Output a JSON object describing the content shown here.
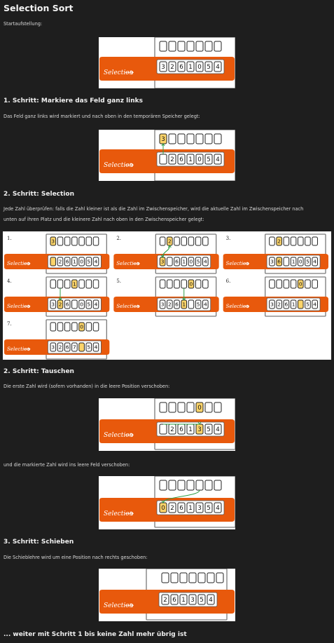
{
  "title": "Selection Sort",
  "start_label": "Startaufstellung:",
  "step1": {
    "heading": "1. Schritt: Markiere das Feld ganz links",
    "text": "Das Feld ganz links wird markiert und nach oben in den temporären Speicher gelegt:"
  },
  "step2": {
    "heading": "2. Schritt: Selection",
    "text_line1": "Jede Zahl überprüfen: falls die Zahl kleiner ist als die Zahl im Zwischenspeicher, wird die aktuelle Zahl im Zwischenspeicher nach",
    "text_line2": "unten auf ihren Platz und die kleinere Zahl nach oben in den Zwischenspeicher gelegt:"
  },
  "step3": {
    "heading": "2. Schritt: Tauschen",
    "text1": "Die erste Zahl wird (sofern vorhanden) in die leere Position verschoben:",
    "text2": "und die markierte Zahl wird ins leere Feld verschoben:"
  },
  "step4": {
    "heading": "3. Schritt: Schieben",
    "text": "Die Schieblehre wird um eine Position nach rechts geschoben:"
  },
  "final": "... weiter mit Schritt 1 bis keine Zahl mehr übrig ist",
  "figure_label": "Selection",
  "colors": {
    "bg": "#1e1e1e",
    "orange": "#e8590c",
    "highlight": "#fcd46a",
    "arrow": "#2f9e44"
  },
  "figures": {
    "start": {
      "top": [
        "",
        "",
        "",
        "",
        "",
        "",
        ""
      ],
      "bottom": [
        "3",
        "2",
        "6",
        "1",
        "0",
        "5",
        "4"
      ]
    },
    "mark": {
      "top": [
        "3",
        "",
        "",
        "",
        "",
        "",
        ""
      ],
      "bottom": [
        "",
        "2",
        "6",
        "1",
        "0",
        "5",
        "4"
      ]
    },
    "grid": [
      {
        "num": "1.",
        "top": [
          "3",
          "",
          "",
          "",
          "",
          "",
          ""
        ],
        "bottom": [
          "",
          "2",
          "6",
          "1",
          "0",
          "5",
          "4"
        ]
      },
      {
        "num": "2.",
        "top": [
          "",
          "2",
          "",
          "",
          "",
          "",
          ""
        ],
        "bottom": [
          "3",
          "",
          "6",
          "1",
          "0",
          "5",
          "4"
        ]
      },
      {
        "num": "3.",
        "top": [
          "",
          "2",
          "",
          "",
          "",
          "",
          ""
        ],
        "bottom": [
          "3",
          "6",
          "",
          "1",
          "0",
          "5",
          "4"
        ]
      },
      {
        "num": "4.",
        "top": [
          "",
          "",
          "",
          "1",
          "",
          "",
          ""
        ],
        "bottom": [
          "3",
          "2",
          "6",
          "",
          "0",
          "5",
          "4"
        ]
      },
      {
        "num": "5.",
        "top": [
          "",
          "",
          "",
          "",
          "0",
          "",
          ""
        ],
        "bottom": [
          "3",
          "2",
          "6",
          "1",
          "",
          "5",
          "4"
        ]
      },
      {
        "num": "6.",
        "top": [
          "",
          "",
          "",
          "",
          "0",
          "",
          ""
        ],
        "bottom": [
          "3",
          "2",
          "6",
          "1",
          "",
          "5",
          "4"
        ]
      },
      {
        "num": "7.",
        "top": [
          "",
          "",
          "",
          "",
          "0",
          "",
          ""
        ],
        "bottom": [
          "3",
          "2",
          "6",
          "7",
          "",
          "5",
          "4"
        ]
      }
    ],
    "swap1": {
      "top": [
        "",
        "",
        "",
        "",
        "0",
        "",
        ""
      ],
      "bottom": [
        "",
        "2",
        "6",
        "1",
        "3",
        "5",
        "4"
      ]
    },
    "swap2": {
      "top": [
        "",
        "",
        "",
        "",
        "",
        "",
        ""
      ],
      "bottom": [
        "0",
        "2",
        "6",
        "1",
        "3",
        "5",
        "4"
      ]
    },
    "shift": {
      "top": [
        "",
        "",
        "",
        "",
        "",
        "",
        ""
      ],
      "bottom": [
        "2",
        "6",
        "1",
        "3",
        "5",
        "4"
      ]
    }
  }
}
